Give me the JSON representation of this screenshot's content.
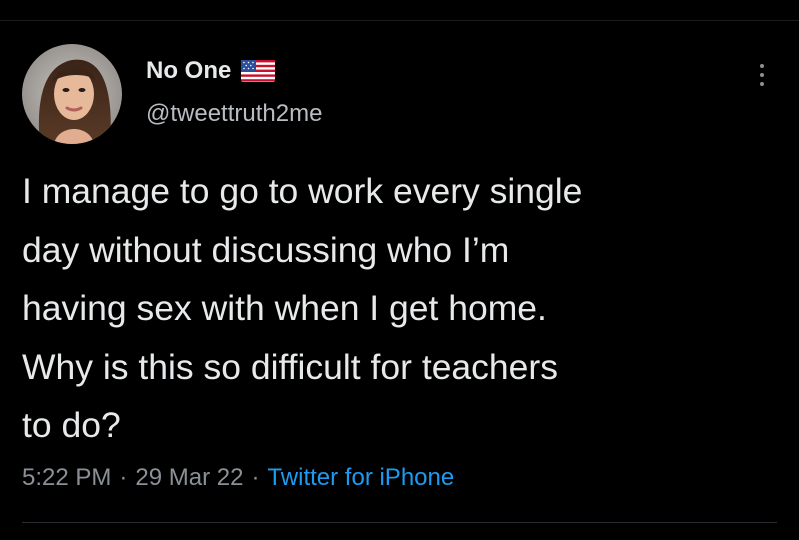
{
  "tweet": {
    "author": {
      "display_name": "No One",
      "handle": "@tweettruth2me",
      "flag_icon": "us-flag-icon"
    },
    "text": "I manage to go to work every single\nday without discussing who I’m\nhaving sex with when I get home.\nWhy is this so difficult for teachers\nto do?",
    "meta": {
      "time": "5:22 PM",
      "separator": "·",
      "date": "29 Mar 22",
      "source": "Twitter for iPhone"
    },
    "menu_icon": "more-options-icon"
  },
  "colors": {
    "background": "#000000",
    "text_primary": "#e7e9ea",
    "text_secondary": "#8b9097",
    "link": "#1d9bf0"
  }
}
